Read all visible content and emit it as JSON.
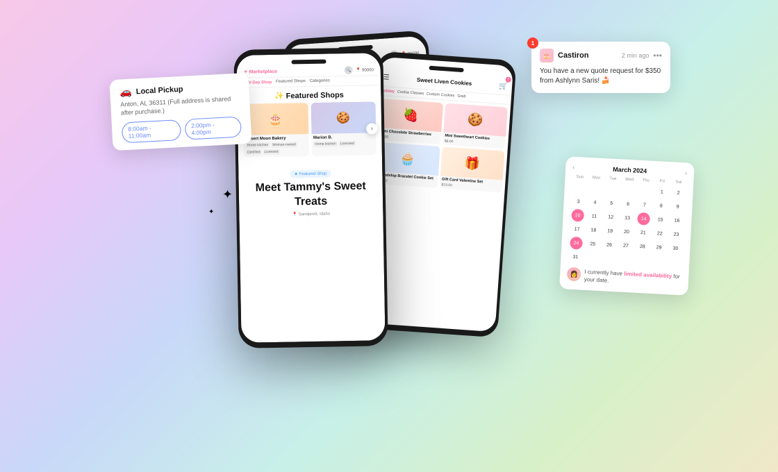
{
  "background": {
    "gradient": "linear-gradient(135deg, #f8c8e8, #e8c8f8, #c8d8f8, #c8f0e8, #d8f0c8)"
  },
  "notification": {
    "app_name": "Castiron",
    "time": "2 min ago",
    "body": "You have a new quote request for $350 from Ashlynn Saris! 🍰",
    "badge": "1"
  },
  "pickup_card": {
    "emoji": "🚗",
    "title": "Local Pickup",
    "address": "Anton, AL 36311 (Full address is shared after purchase.)",
    "time1": "8:00am - 11:00am",
    "time2": "2:00pm - 4:00pm"
  },
  "calendar": {
    "month": "March 2024",
    "day_labels": [
      "Sun",
      "Mon",
      "Tue",
      "Wed",
      "Thu",
      "Fri",
      "Sat"
    ],
    "availability_text": "I currently have limited availability for your date.",
    "days": [
      "",
      "",
      "",
      "",
      "",
      "1",
      "2",
      "3",
      "4",
      "5",
      "6",
      "7",
      "8",
      "9",
      "10",
      "11",
      "12",
      "13",
      "14",
      "15",
      "16",
      "17",
      "18",
      "19",
      "20",
      "21",
      "22",
      "23",
      "24",
      "25",
      "26",
      "27",
      "28",
      "29",
      "30",
      "31",
      "",
      "",
      "",
      "",
      "",
      ""
    ],
    "highlighted_days": [
      "8",
      "9",
      "10",
      "24"
    ],
    "today": "24"
  },
  "phone_back": {
    "logo": "✦ Marketplace",
    "location": "📍 90000",
    "tabs": [
      "V-Day Shop",
      "Featured Shops",
      "Categories"
    ],
    "featured_title": "✨ Featured Shops",
    "shops": [
      {
        "name": "Desert Moon Bakery",
        "emoji": "🎂",
        "tags": [
          "Home kitchen",
          "Woman-owned",
          "Certified",
          "Licensed"
        ]
      },
      {
        "name": "Marion B.",
        "emoji": "🍪",
        "tags": [
          "Home kitchen",
          "Licensed"
        ]
      }
    ],
    "meet_badge": "★ Featured Shop",
    "meet_title": "Meet Tammy's Sweet Treats",
    "meet_location": "📍 Sandpoint, Idaho"
  },
  "phone_right": {
    "title": "Sweet Liven Cookies",
    "tabs": [
      "Holiday",
      "Cookie Classes",
      "Custom Cookies",
      "Grab"
    ],
    "products": [
      {
        "name": "Mini Chocolate Strawberries",
        "emoji": "🍓",
        "price": "$8.00"
      },
      {
        "name": "Mini Sweetheart Cookies",
        "emoji": "🍪",
        "price": "$8.00"
      },
      {
        "name": "Friendship Bracelet Cookie Set",
        "emoji": "🧁",
        "price": "$19.00"
      },
      {
        "name": "Gift Card Valentine Set",
        "emoji": "🎁",
        "price": "$19.00"
      }
    ]
  }
}
